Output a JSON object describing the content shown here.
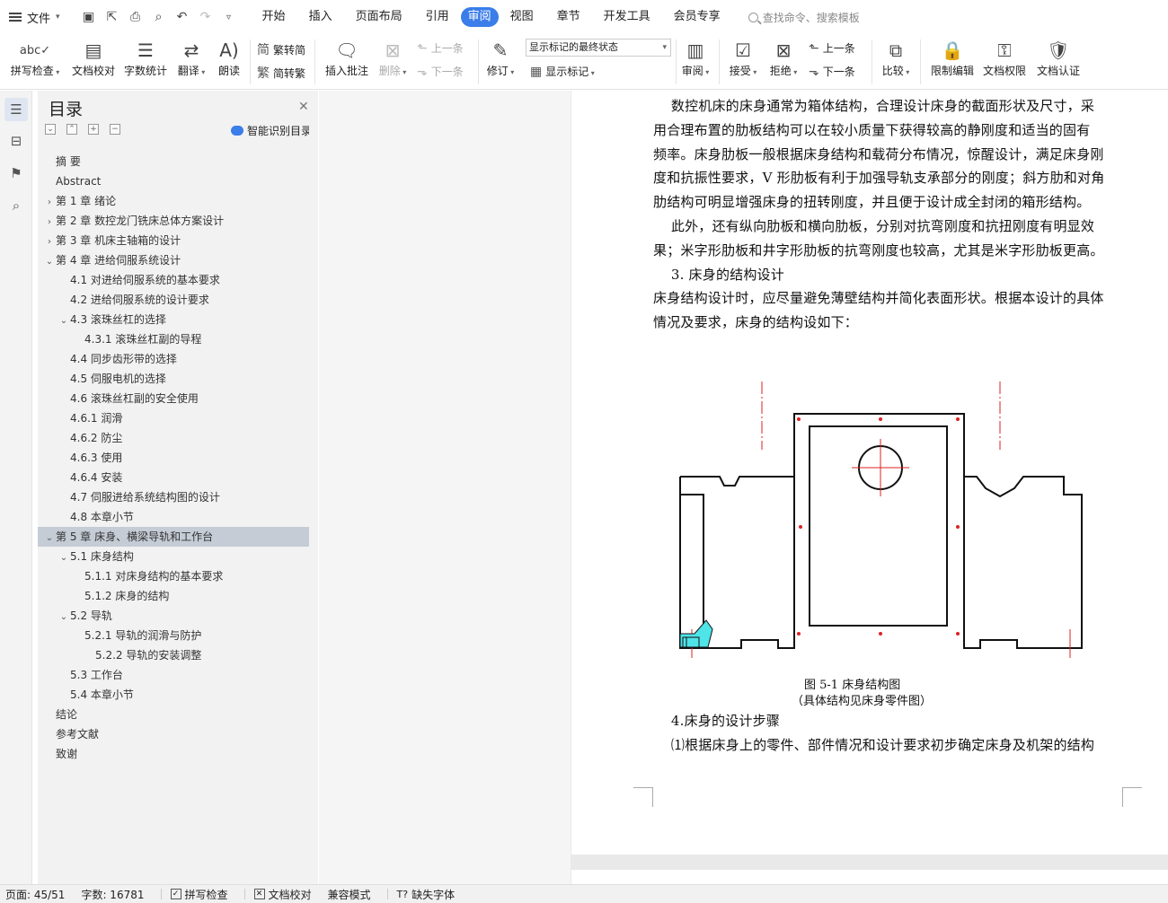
{
  "topbar": {
    "file_menu": "文件",
    "tabs": [
      "开始",
      "插入",
      "页面布局",
      "引用",
      "审阅",
      "视图",
      "章节",
      "开发工具",
      "会员专享"
    ],
    "active_tab": "审阅",
    "search_placeholder": "查找命令、搜索模板"
  },
  "ribbon": {
    "spell_check": "拼写检查",
    "doc_proof": "文档校对",
    "word_count": "字数统计",
    "translate": "翻译",
    "read_aloud": "朗读",
    "trad_to_simp": "繁转简",
    "simp_to_trad": "简转繁",
    "insert_comment": "插入批注",
    "delete": "删除",
    "prev_item": "上一条",
    "next_item": "下一条",
    "track_changes": "修订",
    "display_mode": "显示标记的最终状态",
    "show_markup": "显示标记",
    "review": "审阅",
    "accept": "接受",
    "reject": "拒绝",
    "prev_change": "上一条",
    "next_change": "下一条",
    "compare": "比较",
    "restrict_edit": "限制编辑",
    "doc_permission": "文档权限",
    "doc_certify": "文档认证"
  },
  "toc": {
    "title": "目录",
    "smart_button": "智能识别目录",
    "items": [
      {
        "label": "摘  要",
        "level": 0,
        "chev": ""
      },
      {
        "label": "Abstract",
        "level": 0,
        "chev": ""
      },
      {
        "label": "第 1 章   绪论",
        "level": 0,
        "chev": ">"
      },
      {
        "label": "第 2 章   数控龙门铣床总体方案设计",
        "level": 0,
        "chev": ">"
      },
      {
        "label": "第 3 章  机床主轴箱的设计",
        "level": 0,
        "chev": ">"
      },
      {
        "label": "第 4 章  进给伺服系统设计",
        "level": 0,
        "chev": "v"
      },
      {
        "label": "4.1  对进给伺服系统的基本要求",
        "level": 1,
        "chev": ""
      },
      {
        "label": "4.2 进给伺服系统的设计要求",
        "level": 1,
        "chev": ""
      },
      {
        "label": "4.3 滚珠丝杠的选择",
        "level": 1,
        "chev": "v"
      },
      {
        "label": "4.3.1  滚珠丝杠副的导程",
        "level": 2,
        "chev": ""
      },
      {
        "label": "4.4 同步齿形带的选择",
        "level": 1,
        "chev": ""
      },
      {
        "label": "4.5 伺服电机的选择",
        "level": 1,
        "chev": ""
      },
      {
        "label": "4.6  滚珠丝杠副的安全使用",
        "level": 1,
        "chev": ""
      },
      {
        "label": "4.6.1  润滑",
        "level": 1,
        "chev": ""
      },
      {
        "label": "4.6.2  防尘",
        "level": 1,
        "chev": ""
      },
      {
        "label": "4.6.3 使用",
        "level": 1,
        "chev": ""
      },
      {
        "label": "4.6.4  安装",
        "level": 1,
        "chev": ""
      },
      {
        "label": "4.7  伺服进给系统结构图的设计",
        "level": 1,
        "chev": ""
      },
      {
        "label": "4.8  本章小节",
        "level": 1,
        "chev": ""
      },
      {
        "label": "第 5 章  床身、横梁导轨和工作台",
        "level": 0,
        "chev": "v",
        "selected": true
      },
      {
        "label": "5.1  床身结构",
        "level": 1,
        "chev": "v"
      },
      {
        "label": "5.1.1  对床身结构的基本要求",
        "level": 2,
        "chev": ""
      },
      {
        "label": "5.1.2  床身的结构",
        "level": 2,
        "chev": ""
      },
      {
        "label": "5.2  导轨",
        "level": 1,
        "chev": "v"
      },
      {
        "label": "5.2.1  导轨的润滑与防护",
        "level": 2,
        "chev": ""
      },
      {
        "label": "5.2.2  导轨的安装调整",
        "level": 3,
        "chev": ""
      },
      {
        "label": "5.3  工作台",
        "level": 1,
        "chev": ""
      },
      {
        "label": "5.4  本章小节",
        "level": 1,
        "chev": ""
      },
      {
        "label": "结论",
        "level": 0,
        "chev": ""
      },
      {
        "label": "参考文献",
        "level": 0,
        "chev": ""
      },
      {
        "label": "致谢",
        "level": 0,
        "chev": ""
      }
    ]
  },
  "document": {
    "lines": [
      "    数控机床的床身通常为箱体结构，合理设计床身的截面形状及尺寸，采",
      "用合理布置的肋板结构可以在较小质量下获得较高的静刚度和适当的固有",
      "频率。床身肋板一般根据床身结构和载荷分布情况，惊醒设计，满足床身刚",
      "度和抗振性要求，V 形肋板有利于加强导轨支承部分的刚度；斜方肋和对角",
      "肋结构可明显增强床身的扭转刚度，并且便于设计成全封闭的箱形结构。",
      "    此外，还有纵向肋板和横向肋板，分别对抗弯刚度和抗扭刚度有明显效",
      "果；米字形肋板和井字形肋板的抗弯刚度也较高，尤其是米字形肋板更高。",
      "    3. 床身的结构设计",
      "床身结构设计时，应尽量避免薄壁结构并简化表面形状。根据本设计的具体",
      "情况及要求，床身的结构设如下："
    ],
    "figure_caption": "图 5-1  床身结构图",
    "figure_subcaption": "（具体结构见床身零件图）",
    "after_lines": [
      "    4.床身的设计步骤",
      "    ⑴根据床身上的零件、部件情况和设计要求初步确定床身及机架的结构"
    ]
  },
  "statusbar": {
    "page": "页面: 45/51",
    "word_count": "字数: 16781",
    "spell_check": "拼写检查",
    "doc_proof": "文档校对",
    "compat_mode": "兼容模式",
    "missing_fonts": "缺失字体"
  }
}
